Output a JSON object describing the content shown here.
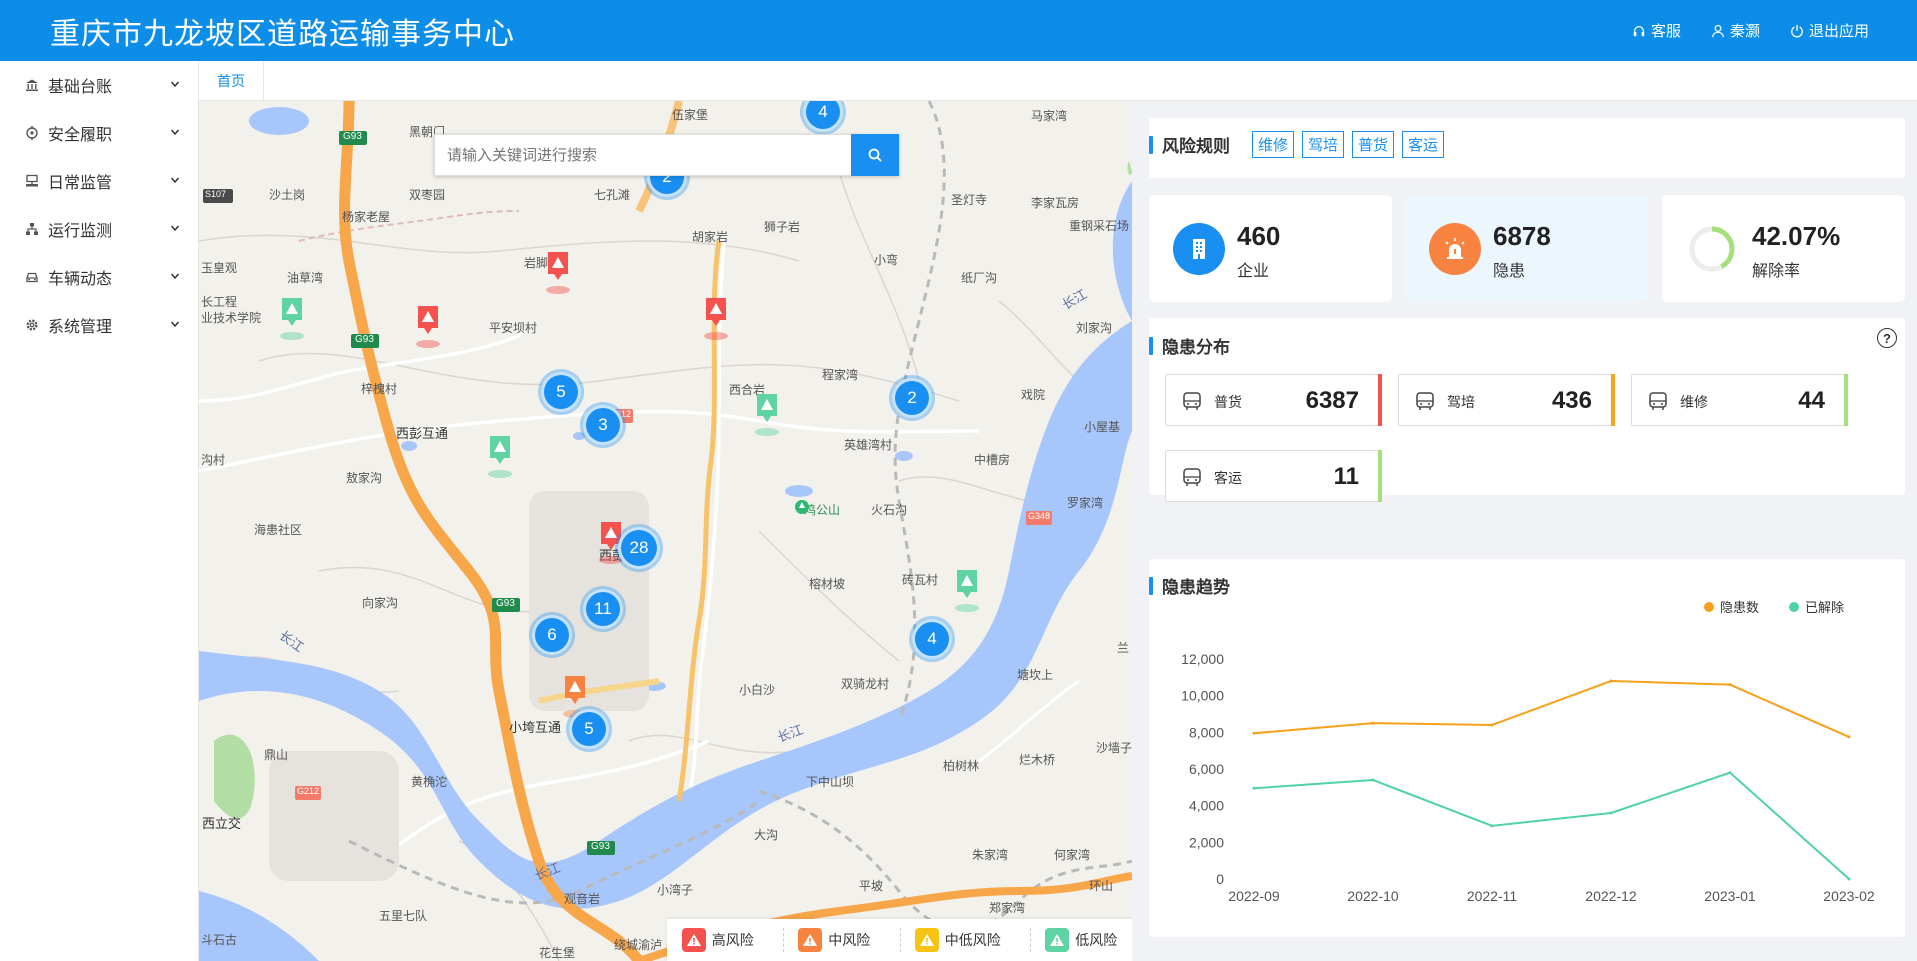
{
  "header": {
    "title": "重庆市九龙坡区道路运输事务中心",
    "service": "客服",
    "user": "秦灏",
    "logout": "退出应用"
  },
  "sidebar": {
    "items": [
      {
        "label": "基础台账",
        "icon": "bank-icon"
      },
      {
        "label": "安全履职",
        "icon": "target-icon"
      },
      {
        "label": "日常监管",
        "icon": "monitor-icon"
      },
      {
        "label": "运行监测",
        "icon": "network-icon"
      },
      {
        "label": "车辆动态",
        "icon": "car-icon"
      },
      {
        "label": "系统管理",
        "icon": "gear-icon"
      }
    ]
  },
  "tabs": [
    {
      "label": "首页"
    }
  ],
  "map": {
    "search_placeholder": "请输入关键词进行搜索",
    "clusters": [
      "4",
      "2",
      "5",
      "3",
      "2",
      "28",
      "11",
      "6",
      "4",
      "5"
    ],
    "labels": {
      "l1": "黑朝门",
      "l2": "沙土岗",
      "l3": "双枣园",
      "l4": "七孔滩",
      "l5": "胡家岩",
      "l6": "狮子岩",
      "l7": "伍家堡",
      "l8": "杨家老屋",
      "l9": "玉皇观",
      "l10": "油草湾",
      "l11": "岩脚",
      "l12": "小弯",
      "l13": "圣灯寺",
      "l14": "李家瓦房",
      "l15": "重钢采石场",
      "l16": "马家湾",
      "l17": "纸厂沟",
      "l18": "刘家沟",
      "l19": "平安坝村",
      "l20": "程家湾",
      "l21": "西合岩",
      "l22": "戏院",
      "l23": "小屋基",
      "l24": "梓槐村",
      "l25": "西彭互通",
      "l26": "英雄湾村",
      "l27": "中槽房",
      "l28": "敖家沟",
      "l29": "鸡公山",
      "l30": "火石沟",
      "l31": "罗家湾",
      "l32": "海患社区",
      "l33": "向家沟",
      "l34": "西彭",
      "l35": "榕材坡",
      "l36": "砖瓦村",
      "l37": "小白沙",
      "l38": "双骑龙村",
      "l39": "塘坎上",
      "l40": "小垮互通",
      "l41": "鼎山",
      "l42": "黄桷沱",
      "l43": "下中山坝",
      "l44": "柏树林",
      "l45": "烂木桥",
      "l46": "沙墙子",
      "l47": "西立交",
      "l48": "大沟",
      "l49": "朱家湾",
      "l50": "何家湾",
      "l51": "小湾子",
      "l52": "平坡",
      "l53": "环山",
      "l54": "五里七队",
      "l55": "观音岩",
      "l56": "郑家湾",
      "l57": "绕城渝泸",
      "l58": "花生堡",
      "l59": "斗石古",
      "l60": "长工程",
      "l61": "业技术学院",
      "l62": "兰",
      "l63": "沟村"
    },
    "rivers": [
      "长江",
      "长江",
      "长江",
      "长江"
    ],
    "roads": [
      "G93",
      "G93",
      "G93",
      "G93",
      "G212",
      "G212",
      "S107",
      "G348"
    ],
    "legend": [
      {
        "label": "高风险",
        "color": "#f4524f"
      },
      {
        "label": "中风险",
        "color": "#f88240"
      },
      {
        "label": "中低风险",
        "color": "#f7c413"
      },
      {
        "label": "低风险",
        "color": "#5fd3a4"
      }
    ]
  },
  "risk": {
    "title": "风险规则",
    "tags": [
      "维修",
      "驾培",
      "普货",
      "客运"
    ]
  },
  "stats": [
    {
      "value": "460",
      "label": "企业",
      "color": "#1a8ff2",
      "icon": "building-icon"
    },
    {
      "value": "6878",
      "label": "隐患",
      "color": "#f88240",
      "icon": "alarm-icon"
    },
    {
      "value": "42.07%",
      "label": "解除率",
      "ring_fraction": 0.4207
    }
  ],
  "hazards": {
    "title": "隐患分布",
    "help": "?",
    "items": [
      {
        "label": "普货",
        "value": "6387",
        "color": "#f4524f"
      },
      {
        "label": "驾培",
        "value": "436",
        "color": "#f7a01b"
      },
      {
        "label": "维修",
        "value": "44",
        "color": "#a6e07c"
      },
      {
        "label": "客运",
        "value": "11",
        "color": "#a6e07c"
      }
    ]
  },
  "trend": {
    "title": "隐患趋势"
  },
  "chart_data": {
    "type": "line",
    "x": [
      "2022-09",
      "2022-10",
      "2022-11",
      "2022-12",
      "2023-01",
      "2023-02"
    ],
    "series": [
      {
        "name": "隐患数",
        "color": "#f7a01b",
        "values": [
          7950,
          8500,
          8400,
          10800,
          10600,
          7750
        ]
      },
      {
        "name": "已解除",
        "color": "#4fd3a2",
        "values": [
          4950,
          5400,
          2900,
          3600,
          5800,
          0
        ]
      }
    ],
    "ylim": [
      0,
      12000
    ],
    "yticks": [
      "0",
      "2,000",
      "4,000",
      "6,000",
      "8,000",
      "10,000",
      "12,000"
    ],
    "legend_position": "top-right",
    "grid": false
  }
}
